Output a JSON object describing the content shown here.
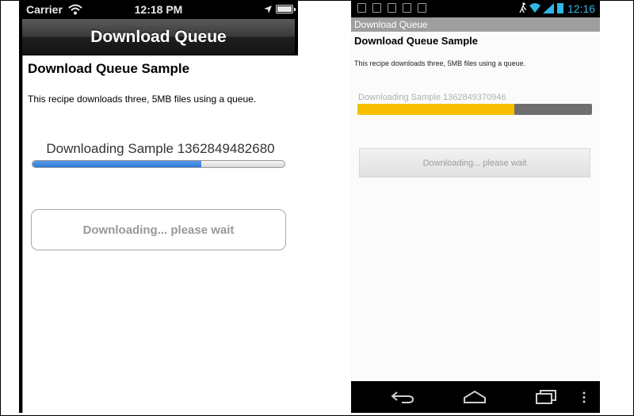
{
  "ios": {
    "status_bar": {
      "carrier": "Carrier",
      "time": "12:18 PM"
    },
    "nav_bar": {
      "title": "Download Queue"
    },
    "content": {
      "heading": "Download Queue Sample",
      "description": "This recipe downloads three, 5MB files using a queue.",
      "download_label": "Downloading Sample 1362849482680",
      "progress": 0.67,
      "button_label": "Downloading... please wait"
    }
  },
  "android": {
    "status_bar": {
      "time": "12:16"
    },
    "title_bar": {
      "title": "Download Queue"
    },
    "content": {
      "heading": "Download Queue Sample",
      "description": "This recipe downloads three, 5MB files using a queue.",
      "download_label": "Downloading Sample 1362849370946",
      "progress": 0.67,
      "button_label": "Downloading... please wait"
    }
  },
  "colors": {
    "ios_progress": "#2f7ad8",
    "android_progress": "#f6c000",
    "android_accent": "#33b5e5"
  },
  "icons": [
    "wifi-icon",
    "location-arrow-icon",
    "battery-icon",
    "gallery-icon",
    "notification-icon",
    "usb-icon",
    "camera-icon",
    "android-debug-icon",
    "walking-man-icon",
    "signal-icon",
    "back-icon",
    "home-icon",
    "recent-apps-icon",
    "menu-icon"
  ]
}
